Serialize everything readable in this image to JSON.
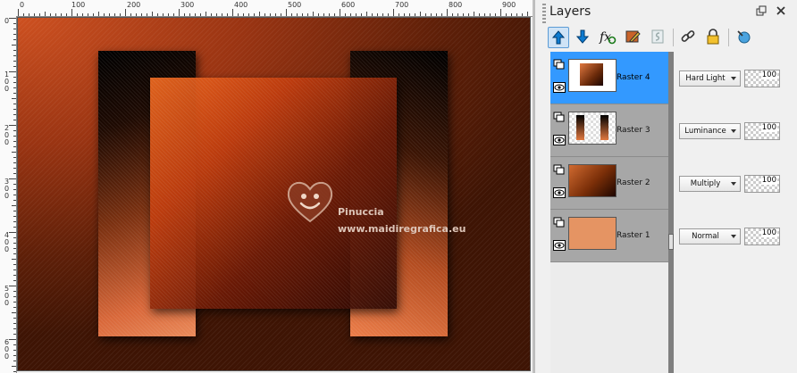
{
  "ruler": {
    "horizontal_labels": [
      "0",
      "100",
      "200",
      "300",
      "400",
      "500",
      "600",
      "700",
      "800",
      "900"
    ],
    "vertical_labels": [
      "0",
      "1 0 0",
      "2 0 0",
      "3 0 0",
      "4 0 0",
      "5 0 0",
      "6 0 0"
    ]
  },
  "canvas": {
    "watermark": {
      "name": "Pinuccia",
      "url": "www.maidiregrafica.eu"
    }
  },
  "palette": {
    "title": "Layers",
    "title_buttons": [
      "pin-icon",
      "close-icon"
    ],
    "toolbar": [
      {
        "name": "move-layer-up-icon"
      },
      {
        "name": "move-layer-down-icon"
      },
      {
        "name": "effects-fx-icon"
      },
      {
        "name": "edit-layer-icon"
      },
      {
        "name": "mask-icon"
      },
      {
        "name": "link-icon"
      },
      {
        "name": "lock-icon"
      },
      {
        "name": "overview-icon"
      }
    ],
    "layers": [
      {
        "label": "Raster 4",
        "blend": "Hard Light",
        "opacity": "100",
        "selected": true
      },
      {
        "label": "Raster 3",
        "blend": "Luminance",
        "opacity": "100",
        "selected": false
      },
      {
        "label": "Raster 2",
        "blend": "Multiply",
        "opacity": "100",
        "selected": false
      },
      {
        "label": "Raster 1",
        "blend": "Normal",
        "opacity": "100",
        "selected": false
      }
    ]
  },
  "colors": {
    "selection": "#3399ff",
    "layer_list_bg": "#a7a7a7",
    "raster1_fill": "#e59463"
  }
}
